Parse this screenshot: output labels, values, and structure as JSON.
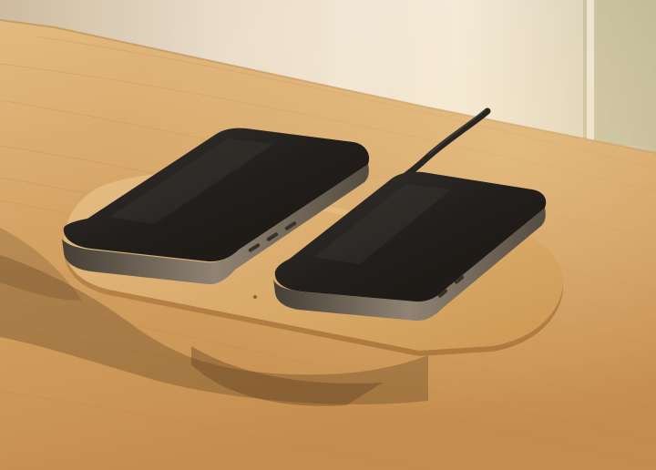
{
  "photo": {
    "subject": "",
    "colors": {
      "wall": "#e6dccd",
      "wall_shadow": "#cfc3ae",
      "window_light": "#f1ede4",
      "window_green": "#b9b79a",
      "table_light": "#d9ad72",
      "table_mid": "#c8934f",
      "table_dark": "#a87438",
      "pad_top": "#d6a766",
      "pad_edge": "#b98448",
      "phone_body": "#1a1a1a",
      "phone_frame": "#6b6258",
      "phone_screen": "#0f0f10",
      "cable": "#1c1c1c",
      "shadow": "#5a3d1e"
    },
    "objects": [
      {
        "name": "table",
        "icon": "wood-table"
      },
      {
        "name": "charging-pad",
        "icon": "oval-wooden-pad"
      },
      {
        "name": "phone-left",
        "icon": "smartphone-face-down"
      },
      {
        "name": "phone-right",
        "icon": "smartphone-face-down"
      },
      {
        "name": "cable",
        "icon": "black-cable"
      }
    ]
  }
}
